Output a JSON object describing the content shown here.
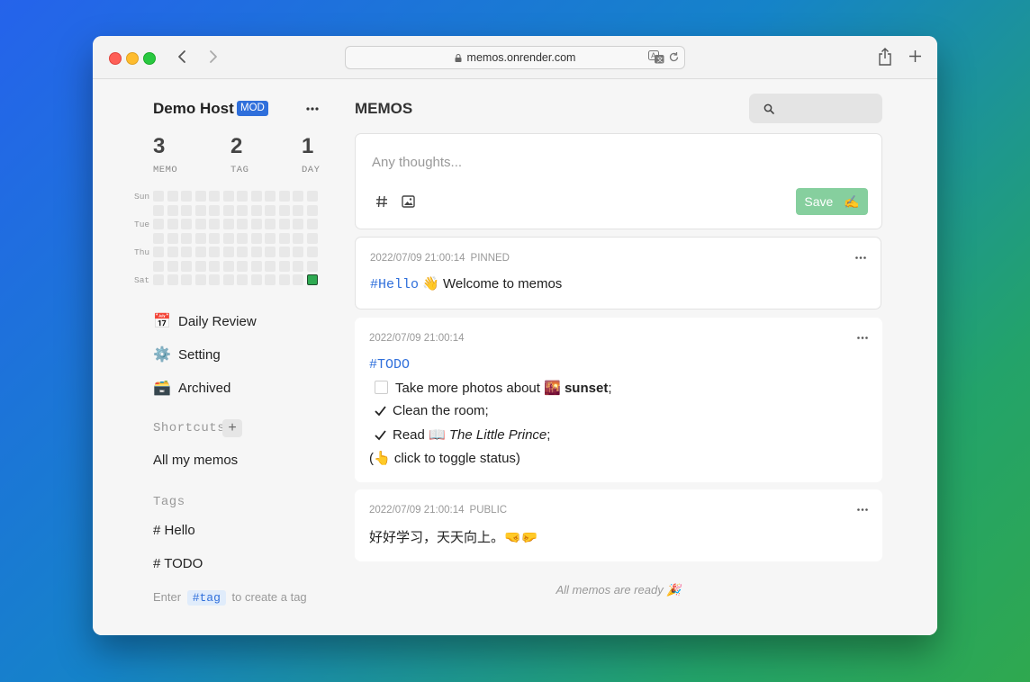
{
  "browser": {
    "url": "memos.onrender.com"
  },
  "sidebar": {
    "user_name": "Demo Host",
    "role_badge": "MOD",
    "stats": [
      {
        "value": "3",
        "label": "MEMO"
      },
      {
        "value": "2",
        "label": "TAG"
      },
      {
        "value": "1",
        "label": "DAY"
      }
    ],
    "heatmap": {
      "day_labels": [
        "Sun",
        "Tue",
        "Thu",
        "Sat"
      ],
      "active_cells": 1
    },
    "nav_items": [
      {
        "icon": "📅",
        "label": "Daily Review"
      },
      {
        "icon": "⚙️",
        "label": "Setting"
      },
      {
        "icon": "🗃️",
        "label": "Archived"
      }
    ],
    "shortcuts_title": "Shortcuts",
    "shortcuts": [
      "All my memos"
    ],
    "tags_title": "Tags",
    "tags": [
      "Hello",
      "TODO"
    ],
    "tag_hint": {
      "before": "Enter",
      "code": "#tag",
      "after": "to create a tag"
    }
  },
  "main": {
    "title": "MEMOS",
    "editor": {
      "placeholder": "Any thoughts...",
      "save_label": "Save",
      "save_emoji": "✍️"
    },
    "memos": [
      {
        "timestamp": "2022/07/09 21:00:14",
        "status": "PINNED",
        "tag": "#Hello",
        "text": "👋 Welcome to memos"
      },
      {
        "timestamp": "2022/07/09 21:00:14",
        "status": "",
        "tag": "#TODO",
        "todos": [
          {
            "checked": false,
            "text": "Take more photos about",
            "emoji": "🌇",
            "bold": "sunset",
            "end": ";"
          },
          {
            "checked": true,
            "text": "Clean the room;"
          },
          {
            "checked": true,
            "text": "Read",
            "emoji": "📖",
            "italic": "The Little Prince",
            "end": ";"
          }
        ],
        "note_open": "(",
        "note_emoji": "👆",
        "note_text": "click to toggle status)"
      },
      {
        "timestamp": "2022/07/09 21:00:14",
        "status": "PUBLIC",
        "text": "好好学习，天天向上。🤜🤛"
      }
    ],
    "footer": "All memos are ready 🎉"
  }
}
